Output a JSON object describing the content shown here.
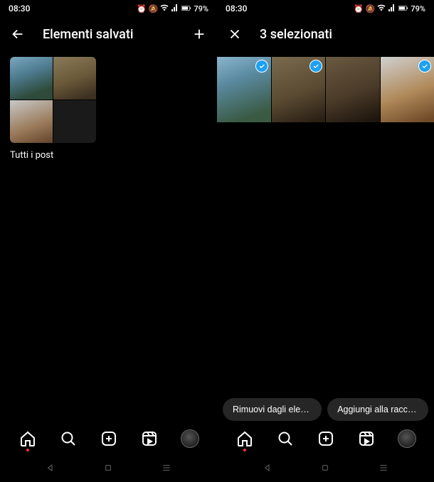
{
  "status": {
    "time": "08:30",
    "battery": "79%"
  },
  "left": {
    "title": "Elementi salvati",
    "collection_label": "Tutti i post"
  },
  "right": {
    "title": "3 selezionati",
    "actions": {
      "remove": "Rimuovi dagli elem…",
      "add": "Aggiungi alla raccol…"
    }
  },
  "icons": {
    "back": "back-arrow-icon",
    "plus": "plus-icon",
    "close": "close-icon",
    "home": "home-icon",
    "search": "search-icon",
    "new": "new-post-icon",
    "reels": "reels-icon",
    "profile": "profile-avatar",
    "android_back": "android-back-icon",
    "android_home": "android-home-icon",
    "android_recent": "android-recent-icon",
    "check": "selected-check-icon"
  }
}
